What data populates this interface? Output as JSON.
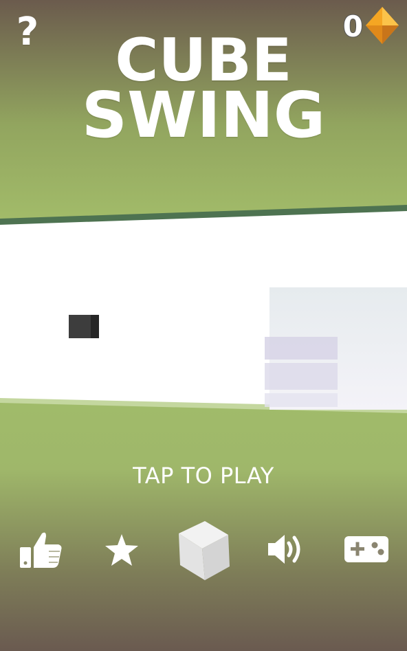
{
  "hud": {
    "help_label": "?",
    "gem_count": "0",
    "gem_icon": "orange-diamond-icon"
  },
  "title": {
    "line1": "CUBE",
    "line2": "SWING"
  },
  "prompt": "TAP TO PLAY",
  "bottom_bar": [
    {
      "name": "rate-button",
      "icon": "thumbs-up-icon"
    },
    {
      "name": "leaderboard-button",
      "icon": "star-icon"
    },
    {
      "name": "cube-select-button",
      "icon": "cube-icon"
    },
    {
      "name": "sound-button",
      "icon": "speaker-icon"
    },
    {
      "name": "more-games-button",
      "icon": "gamepad-icon"
    }
  ],
  "colors": {
    "sky_top": "#6b5b4d",
    "sky_mid": "#a2ba6c",
    "ground_dark": "#4e7351",
    "play_area": "#ffffff",
    "player_cube": "#3a3a3a",
    "gem": "#f5a623",
    "ui_text": "#ffffff"
  }
}
